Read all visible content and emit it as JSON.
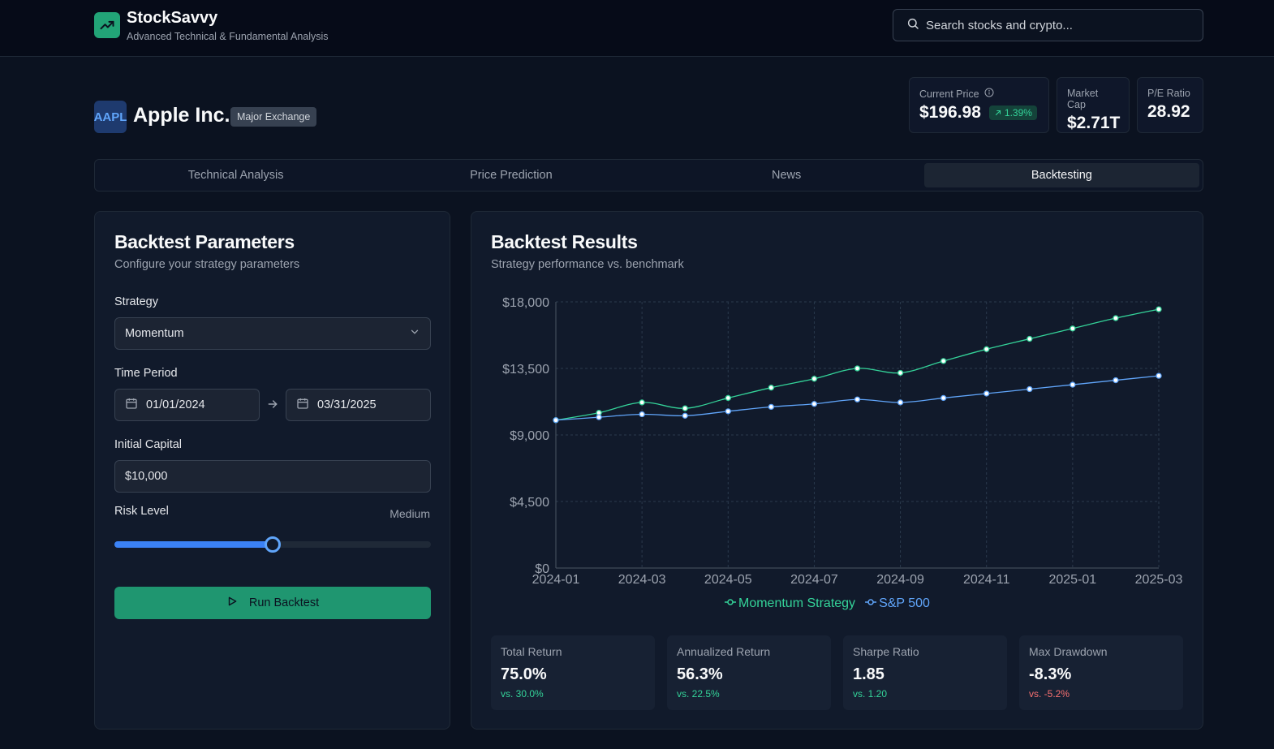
{
  "brand": {
    "name": "StockSavvy",
    "tagline": "Advanced Technical & Fundamental Analysis"
  },
  "search": {
    "placeholder": "Search stocks and crypto..."
  },
  "stock": {
    "ticker": "AAPL",
    "name": "Apple Inc.",
    "exchange": "Major Exchange",
    "current_price_label": "Current Price",
    "current_price": "$196.98",
    "change": "1.39%",
    "market_cap_label": "Market Cap",
    "market_cap": "$2.71T",
    "pe_label": "P/E Ratio",
    "pe": "28.92"
  },
  "tabs": [
    {
      "label": "Technical Analysis",
      "active": false
    },
    {
      "label": "Price Prediction",
      "active": false
    },
    {
      "label": "News",
      "active": false
    },
    {
      "label": "Backtesting",
      "active": true
    }
  ],
  "params": {
    "title": "Backtest Parameters",
    "subtitle": "Configure your strategy parameters",
    "strategy_label": "Strategy",
    "strategy_value": "Momentum",
    "period_label": "Time Period",
    "start_date": "01/01/2024",
    "end_date": "03/31/2025",
    "capital_label": "Initial Capital",
    "capital_value": "$10,000",
    "risk_label": "Risk Level",
    "risk_value": "Medium",
    "risk_level": 0.5,
    "run_label": "Run Backtest"
  },
  "results": {
    "title": "Backtest Results",
    "subtitle": "Strategy performance vs. benchmark",
    "metrics": [
      {
        "label": "Total Return",
        "value": "75.0%",
        "compare": "vs. 30.0%",
        "compare_color": "#34d399"
      },
      {
        "label": "Annualized Return",
        "value": "56.3%",
        "compare": "vs. 22.5%",
        "compare_color": "#34d399"
      },
      {
        "label": "Sharpe Ratio",
        "value": "1.85",
        "compare": "vs. 1.20",
        "compare_color": "#34d399"
      },
      {
        "label": "Max Drawdown",
        "value": "-8.3%",
        "compare": "vs. -5.2%",
        "compare_color": "#f87171"
      }
    ]
  },
  "chart_data": {
    "type": "line",
    "x": [
      "2024-01",
      "2024-02",
      "2024-03",
      "2024-04",
      "2024-05",
      "2024-06",
      "2024-07",
      "2024-08",
      "2024-09",
      "2024-10",
      "2024-11",
      "2024-12",
      "2025-01",
      "2025-02",
      "2025-03"
    ],
    "x_tick_labels": [
      "2024-01",
      "2024-03",
      "2024-05",
      "2024-07",
      "2024-09",
      "2024-11",
      "2025-01",
      "2025-03"
    ],
    "y_tick_labels": [
      "$0",
      "$4,500",
      "$9,000",
      "$13,500",
      "$18,000"
    ],
    "y_ticks": [
      0,
      4500,
      9000,
      13500,
      18000
    ],
    "ylim": [
      0,
      18000
    ],
    "grid": true,
    "legend_placement": "bottom",
    "series": [
      {
        "name": "Momentum Strategy",
        "color": "#34d399",
        "values": [
          10000,
          10500,
          11200,
          10800,
          11500,
          12200,
          12800,
          13500,
          13200,
          14000,
          14800,
          15500,
          16200,
          16900,
          17500
        ]
      },
      {
        "name": "S&P 500",
        "color": "#60a5fa",
        "values": [
          10000,
          10200,
          10400,
          10300,
          10600,
          10900,
          11100,
          11400,
          11200,
          11500,
          11800,
          12100,
          12400,
          12700,
          13000
        ]
      }
    ]
  },
  "colors": {
    "accent_green": "#22a477",
    "accent_blue": "#3b82f6",
    "background": "#0b1220"
  },
  "icons": {
    "logo": "trending-up-icon",
    "search": "search-icon",
    "info": "info-icon",
    "calendar": "calendar-icon",
    "play": "play-icon",
    "chevron": "chevron-down-icon"
  }
}
